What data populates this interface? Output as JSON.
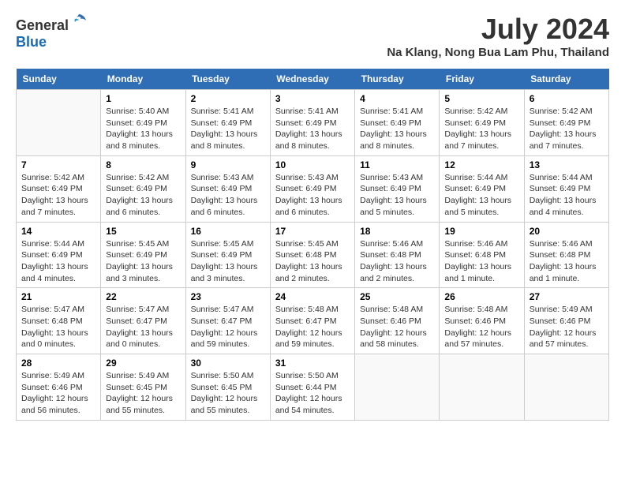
{
  "logo": {
    "general": "General",
    "blue": "Blue"
  },
  "title": "July 2024",
  "location": "Na Klang, Nong Bua Lam Phu, Thailand",
  "weekdays": [
    "Sunday",
    "Monday",
    "Tuesday",
    "Wednesday",
    "Thursday",
    "Friday",
    "Saturday"
  ],
  "weeks": [
    [
      {
        "day": "",
        "info": ""
      },
      {
        "day": "1",
        "info": "Sunrise: 5:40 AM\nSunset: 6:49 PM\nDaylight: 13 hours\nand 8 minutes."
      },
      {
        "day": "2",
        "info": "Sunrise: 5:41 AM\nSunset: 6:49 PM\nDaylight: 13 hours\nand 8 minutes."
      },
      {
        "day": "3",
        "info": "Sunrise: 5:41 AM\nSunset: 6:49 PM\nDaylight: 13 hours\nand 8 minutes."
      },
      {
        "day": "4",
        "info": "Sunrise: 5:41 AM\nSunset: 6:49 PM\nDaylight: 13 hours\nand 8 minutes."
      },
      {
        "day": "5",
        "info": "Sunrise: 5:42 AM\nSunset: 6:49 PM\nDaylight: 13 hours\nand 7 minutes."
      },
      {
        "day": "6",
        "info": "Sunrise: 5:42 AM\nSunset: 6:49 PM\nDaylight: 13 hours\nand 7 minutes."
      }
    ],
    [
      {
        "day": "7",
        "info": ""
      },
      {
        "day": "8",
        "info": "Sunrise: 5:42 AM\nSunset: 6:49 PM\nDaylight: 13 hours\nand 6 minutes."
      },
      {
        "day": "9",
        "info": "Sunrise: 5:43 AM\nSunset: 6:49 PM\nDaylight: 13 hours\nand 6 minutes."
      },
      {
        "day": "10",
        "info": "Sunrise: 5:43 AM\nSunset: 6:49 PM\nDaylight: 13 hours\nand 6 minutes."
      },
      {
        "day": "11",
        "info": "Sunrise: 5:43 AM\nSunset: 6:49 PM\nDaylight: 13 hours\nand 5 minutes."
      },
      {
        "day": "12",
        "info": "Sunrise: 5:44 AM\nSunset: 6:49 PM\nDaylight: 13 hours\nand 5 minutes."
      },
      {
        "day": "13",
        "info": "Sunrise: 5:44 AM\nSunset: 6:49 PM\nDaylight: 13 hours\nand 4 minutes."
      }
    ],
    [
      {
        "day": "14",
        "info": ""
      },
      {
        "day": "15",
        "info": "Sunrise: 5:45 AM\nSunset: 6:49 PM\nDaylight: 13 hours\nand 3 minutes."
      },
      {
        "day": "16",
        "info": "Sunrise: 5:45 AM\nSunset: 6:49 PM\nDaylight: 13 hours\nand 3 minutes."
      },
      {
        "day": "17",
        "info": "Sunrise: 5:45 AM\nSunset: 6:48 PM\nDaylight: 13 hours\nand 2 minutes."
      },
      {
        "day": "18",
        "info": "Sunrise: 5:46 AM\nSunset: 6:48 PM\nDaylight: 13 hours\nand 2 minutes."
      },
      {
        "day": "19",
        "info": "Sunrise: 5:46 AM\nSunset: 6:48 PM\nDaylight: 13 hours\nand 1 minute."
      },
      {
        "day": "20",
        "info": "Sunrise: 5:46 AM\nSunset: 6:48 PM\nDaylight: 13 hours\nand 1 minute."
      }
    ],
    [
      {
        "day": "21",
        "info": ""
      },
      {
        "day": "22",
        "info": "Sunrise: 5:47 AM\nSunset: 6:47 PM\nDaylight: 13 hours\nand 0 minutes."
      },
      {
        "day": "23",
        "info": "Sunrise: 5:47 AM\nSunset: 6:47 PM\nDaylight: 12 hours\nand 59 minutes."
      },
      {
        "day": "24",
        "info": "Sunrise: 5:48 AM\nSunset: 6:47 PM\nDaylight: 12 hours\nand 59 minutes."
      },
      {
        "day": "25",
        "info": "Sunrise: 5:48 AM\nSunset: 6:46 PM\nDaylight: 12 hours\nand 58 minutes."
      },
      {
        "day": "26",
        "info": "Sunrise: 5:48 AM\nSunset: 6:46 PM\nDaylight: 12 hours\nand 57 minutes."
      },
      {
        "day": "27",
        "info": "Sunrise: 5:49 AM\nSunset: 6:46 PM\nDaylight: 12 hours\nand 57 minutes."
      }
    ],
    [
      {
        "day": "28",
        "info": "Sunrise: 5:49 AM\nSunset: 6:46 PM\nDaylight: 12 hours\nand 56 minutes."
      },
      {
        "day": "29",
        "info": "Sunrise: 5:49 AM\nSunset: 6:45 PM\nDaylight: 12 hours\nand 55 minutes."
      },
      {
        "day": "30",
        "info": "Sunrise: 5:50 AM\nSunset: 6:45 PM\nDaylight: 12 hours\nand 55 minutes."
      },
      {
        "day": "31",
        "info": "Sunrise: 5:50 AM\nSunset: 6:44 PM\nDaylight: 12 hours\nand 54 minutes."
      },
      {
        "day": "",
        "info": ""
      },
      {
        "day": "",
        "info": ""
      },
      {
        "day": "",
        "info": ""
      }
    ]
  ],
  "week1_sunday_info": "Sunrise: 5:42 AM\nSunset: 6:49 PM\nDaylight: 13 hours\nand 7 minutes.",
  "week2_sunday_info": "Sunrise: 5:42 AM\nSunset: 6:49 PM\nDaylight: 13 hours\nand 7 minutes.",
  "week3_sunday_info": "Sunrise: 5:44 AM\nSunset: 6:49 PM\nDaylight: 13 hours\nand 4 minutes.",
  "week4_sunday_info": "Sunrise: 5:47 AM\nSunset: 6:48 PM\nDaylight: 13 hours\nand 0 minutes."
}
